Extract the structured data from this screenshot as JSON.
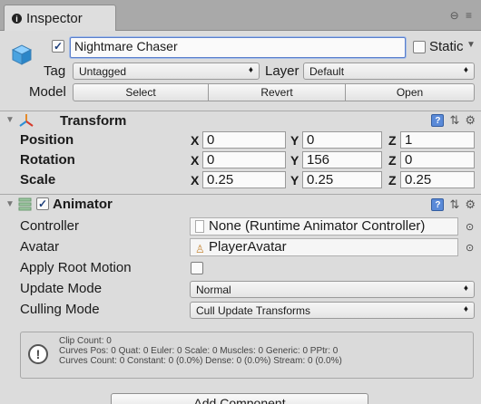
{
  "tab": {
    "title": "Inspector"
  },
  "object": {
    "name": "Nightmare Chaser",
    "static_label": "Static",
    "active": true
  },
  "tag": {
    "label": "Tag",
    "value": "Untagged"
  },
  "layer": {
    "label": "Layer",
    "value": "Default"
  },
  "model": {
    "label": "Model",
    "select": "Select",
    "revert": "Revert",
    "open": "Open"
  },
  "transform": {
    "title": "Transform",
    "position": {
      "label": "Position",
      "x": "0",
      "y": "0",
      "z": "1"
    },
    "rotation": {
      "label": "Rotation",
      "x": "0",
      "y": "156",
      "z": "0"
    },
    "scale": {
      "label": "Scale",
      "x": "0.25",
      "y": "0.25",
      "z": "0.25"
    },
    "axis_x": "X",
    "axis_y": "Y",
    "axis_z": "Z"
  },
  "animator": {
    "title": "Animator",
    "enabled": true,
    "controller": {
      "label": "Controller",
      "value": "None (Runtime Animator Controller)"
    },
    "avatar": {
      "label": "Avatar",
      "value": "PlayerAvatar"
    },
    "apply_root_motion": {
      "label": "Apply Root Motion",
      "checked": false
    },
    "update_mode": {
      "label": "Update Mode",
      "value": "Normal"
    },
    "culling_mode": {
      "label": "Culling Mode",
      "value": "Cull Update Transforms"
    },
    "info": {
      "line1": "Clip Count: 0",
      "line2": "Curves Pos: 0 Quat: 0 Euler: 0 Scale: 0 Muscles: 0 Generic: 0 PPtr: 0",
      "line3": "Curves Count: 0 Constant: 0 (0.0%) Dense: 0 (0.0%) Stream: 0 (0.0%)"
    }
  },
  "add_component": {
    "label": "Add Component"
  },
  "icons": {
    "info": "i",
    "book": "?",
    "presets": "⇅",
    "gear": "⚙",
    "check": "✓",
    "dropdown": "♦",
    "picker": "⊙",
    "alert": "!"
  },
  "colors": {
    "panel": "#dcdcdc",
    "accent": "#5a8ad8",
    "focus": "#5b7fcc"
  }
}
